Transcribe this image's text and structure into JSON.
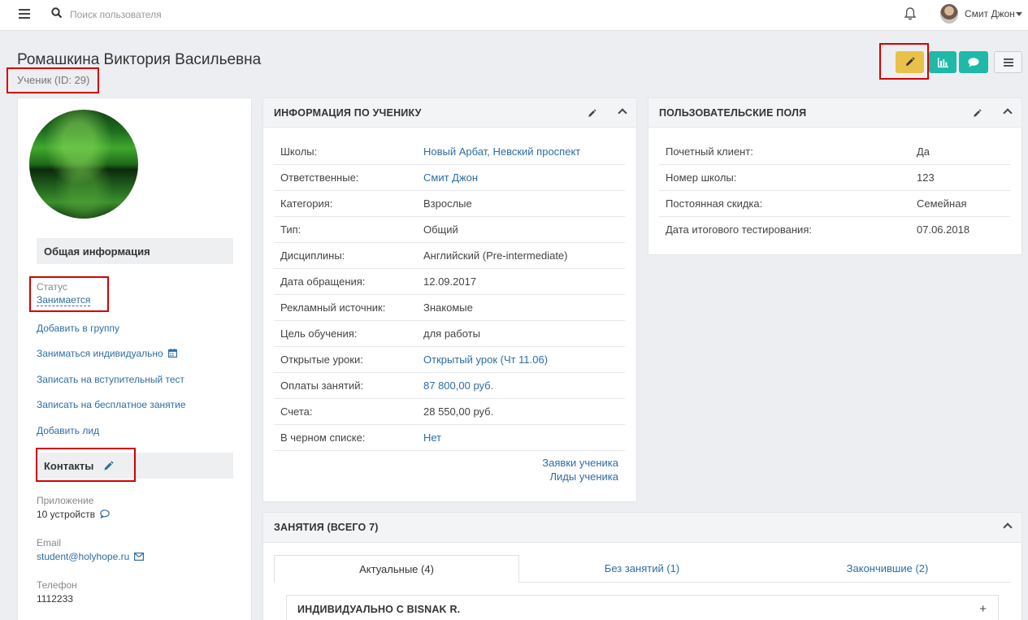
{
  "topbar": {
    "search_placeholder": "Поиск пользователя",
    "user_name": "Смит Джон"
  },
  "header": {
    "title": "Ромашкина Виктория Васильевна",
    "subtitle": "Ученик (ID: 29)"
  },
  "colors": {
    "edit_button": "#e9c14a",
    "accent_teal": "#1fb9a8",
    "link": "#2e6da4",
    "highlight": "#d40000"
  },
  "sidebar": {
    "general_title": "Общая информация",
    "status_label": "Статус",
    "status_value": "Занимается",
    "actions": [
      "Добавить в группу",
      "Заниматься индивидуально",
      "Записать на вступительный тест",
      "Записать на бесплатное занятие",
      "Добавить лид"
    ],
    "contacts_title": "Контакты",
    "app_label": "Приложение",
    "app_value": "10 устройств",
    "email_label": "Email",
    "email_value": "student@holyhope.ru",
    "phone_label": "Телефон",
    "phone_value": "1112233"
  },
  "student_info": {
    "title": "ИНФОРМАЦИЯ ПО УЧЕНИКУ",
    "rows": [
      {
        "k": "Школы:",
        "v": "Новый Арбат, Невский проспект"
      },
      {
        "k": "Ответственные:",
        "v": "Смит Джон"
      },
      {
        "k": "Категория:",
        "v": "Взрослые"
      },
      {
        "k": "Тип:",
        "v": "Общий"
      },
      {
        "k": "Дисциплины:",
        "v": "Английский (Pre-intermediate)"
      },
      {
        "k": "Дата обращения:",
        "v": "12.09.2017"
      },
      {
        "k": "Рекламный источник:",
        "v": "Знакомые"
      },
      {
        "k": "Цель обучения:",
        "v": "для работы"
      },
      {
        "k": "Открытые уроки:",
        "v": "Открытый урок (Чт 11.06)"
      },
      {
        "k": "Оплаты занятий:",
        "v": "87 800,00 руб."
      },
      {
        "k": "Счета:",
        "v": "28 550,00 руб."
      },
      {
        "k": "В черном списке:",
        "v": "Нет"
      }
    ],
    "link_requests": "Заявки ученика",
    "link_leads": "Лиды ученика"
  },
  "custom_fields": {
    "title": "ПОЛЬЗОВАТЕЛЬСКИЕ ПОЛЯ",
    "rows": [
      {
        "k": "Почетный клиент:",
        "v": "Да"
      },
      {
        "k": "Номер школы:",
        "v": "123"
      },
      {
        "k": "Постоянная скидка:",
        "v": "Семейная"
      },
      {
        "k": "Дата итогового тестирования:",
        "v": "07.06.2018"
      }
    ]
  },
  "lessons": {
    "title": "ЗАНЯТИЯ (ВСЕГО 7)",
    "tabs": [
      "Актуальные (4)",
      "Без занятий (1)",
      "Закончившие (2)"
    ],
    "item_title": "ИНДИВИДУАЛЬНО С BISNAK R."
  }
}
